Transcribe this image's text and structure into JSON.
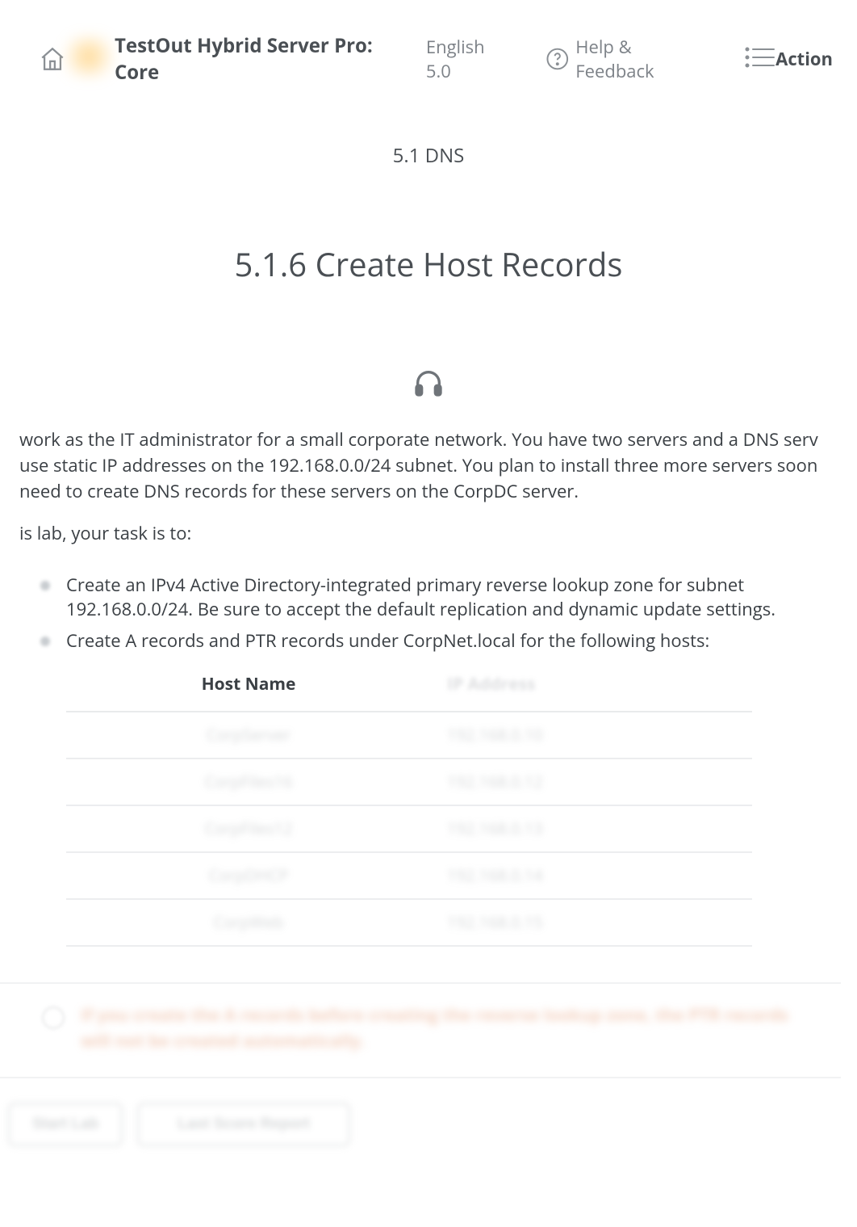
{
  "header": {
    "course_title": "TestOut Hybrid Server Pro: Core",
    "course_version": "English 5.0",
    "help_label": "Help & Feedback",
    "action_label": "Action"
  },
  "section": {
    "number_title": "5.1 DNS",
    "sub_title": "5.1.6 Create Host Records"
  },
  "body": {
    "intro": "work as the IT administrator for a small corporate network. You have two servers and a DNS serv use static IP addresses on the 192.168.0.0/24 subnet. You plan to install three more servers soon need to create DNS records for these servers on the CorpDC server.",
    "task_lead": "is lab, your task is to:",
    "tasks": [
      "Create an IPv4 Active Directory-integrated primary reverse lookup zone for subnet 192.168.0.0/24. Be sure to accept the default replication and dynamic update settings.",
      "Create A records and PTR records under CorpNet.local for the following hosts:"
    ]
  },
  "table": {
    "headers": {
      "host": "Host Name",
      "ip": "IP Address"
    },
    "rows": [
      {
        "host": "CorpServer",
        "ip": "192.168.0.10"
      },
      {
        "host": "CorpFiles16",
        "ip": "192.168.0.12"
      },
      {
        "host": "CorpFiles12",
        "ip": "192.168.0.13"
      },
      {
        "host": "CorpDHCP",
        "ip": "192.168.0.14"
      },
      {
        "host": "CorpWeb",
        "ip": "192.168.0.15"
      }
    ]
  },
  "note": "If you create the A records before creating the reverse lookup zone, the PTR records will not be created automatically.",
  "buttons": {
    "start": "Start Lab",
    "report": "Last Score Report"
  }
}
